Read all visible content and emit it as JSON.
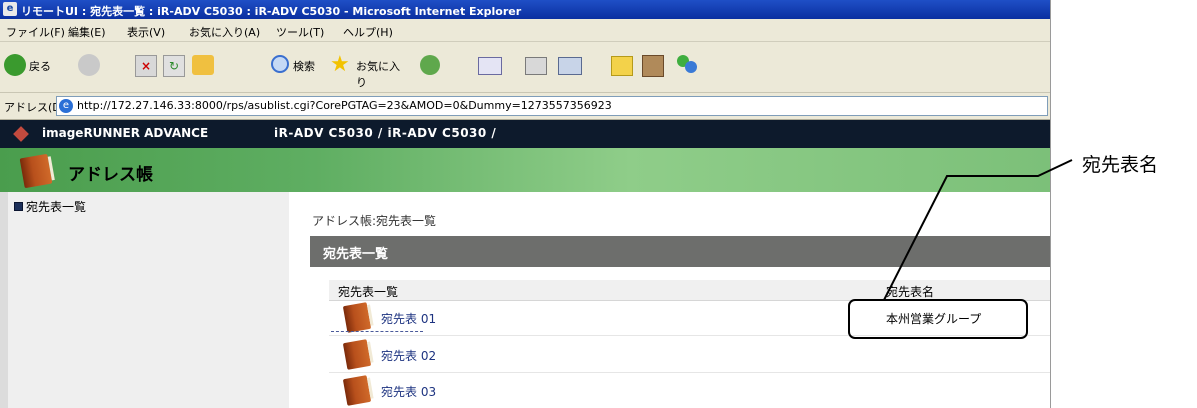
{
  "window": {
    "title": "リモートUI : 宛先表一覧 : iR-ADV C5030 : iR-ADV C5030 - Microsoft Internet Explorer"
  },
  "menu": [
    "ファイル(F)",
    "編集(E)",
    "表示(V)",
    "お気に入り(A)",
    "ツール(T)",
    "ヘルプ(H)"
  ],
  "toolbar": {
    "back_label": "戻る",
    "search_label": "検索",
    "favorites_label": "お気に入り"
  },
  "address": {
    "label": "アドレス(D)",
    "url": "http://172.27.146.33:8000/rps/asublist.cgi?CorePGTAG=23&AMOD=0&Dummy=1273557356923"
  },
  "header": {
    "product": "imageRUNNER ADVANCE",
    "model": "iR-ADV C5030 / iR-ADV C5030 /"
  },
  "page": {
    "title": "アドレス帳"
  },
  "sidebar": {
    "items": [
      {
        "label": "宛先表一覧"
      }
    ]
  },
  "main": {
    "breadcrumb": "アドレス帳:宛先表一覧",
    "section_title": "宛先表一覧",
    "columns": [
      "宛先表一覧",
      "宛先表名"
    ],
    "rows": [
      {
        "list": "宛先表 01",
        "name": "本州営業グループ"
      },
      {
        "list": "宛先表 02",
        "name": ""
      },
      {
        "list": "宛先表 03",
        "name": ""
      }
    ]
  },
  "annotation": {
    "label": "宛先表名"
  },
  "colors": {
    "title_bar": "#0a2fa0",
    "header_bg": "#0d1a2c",
    "green_band": "#5fae62",
    "section_bar": "#6d6e6c",
    "link": "#1d3380"
  }
}
